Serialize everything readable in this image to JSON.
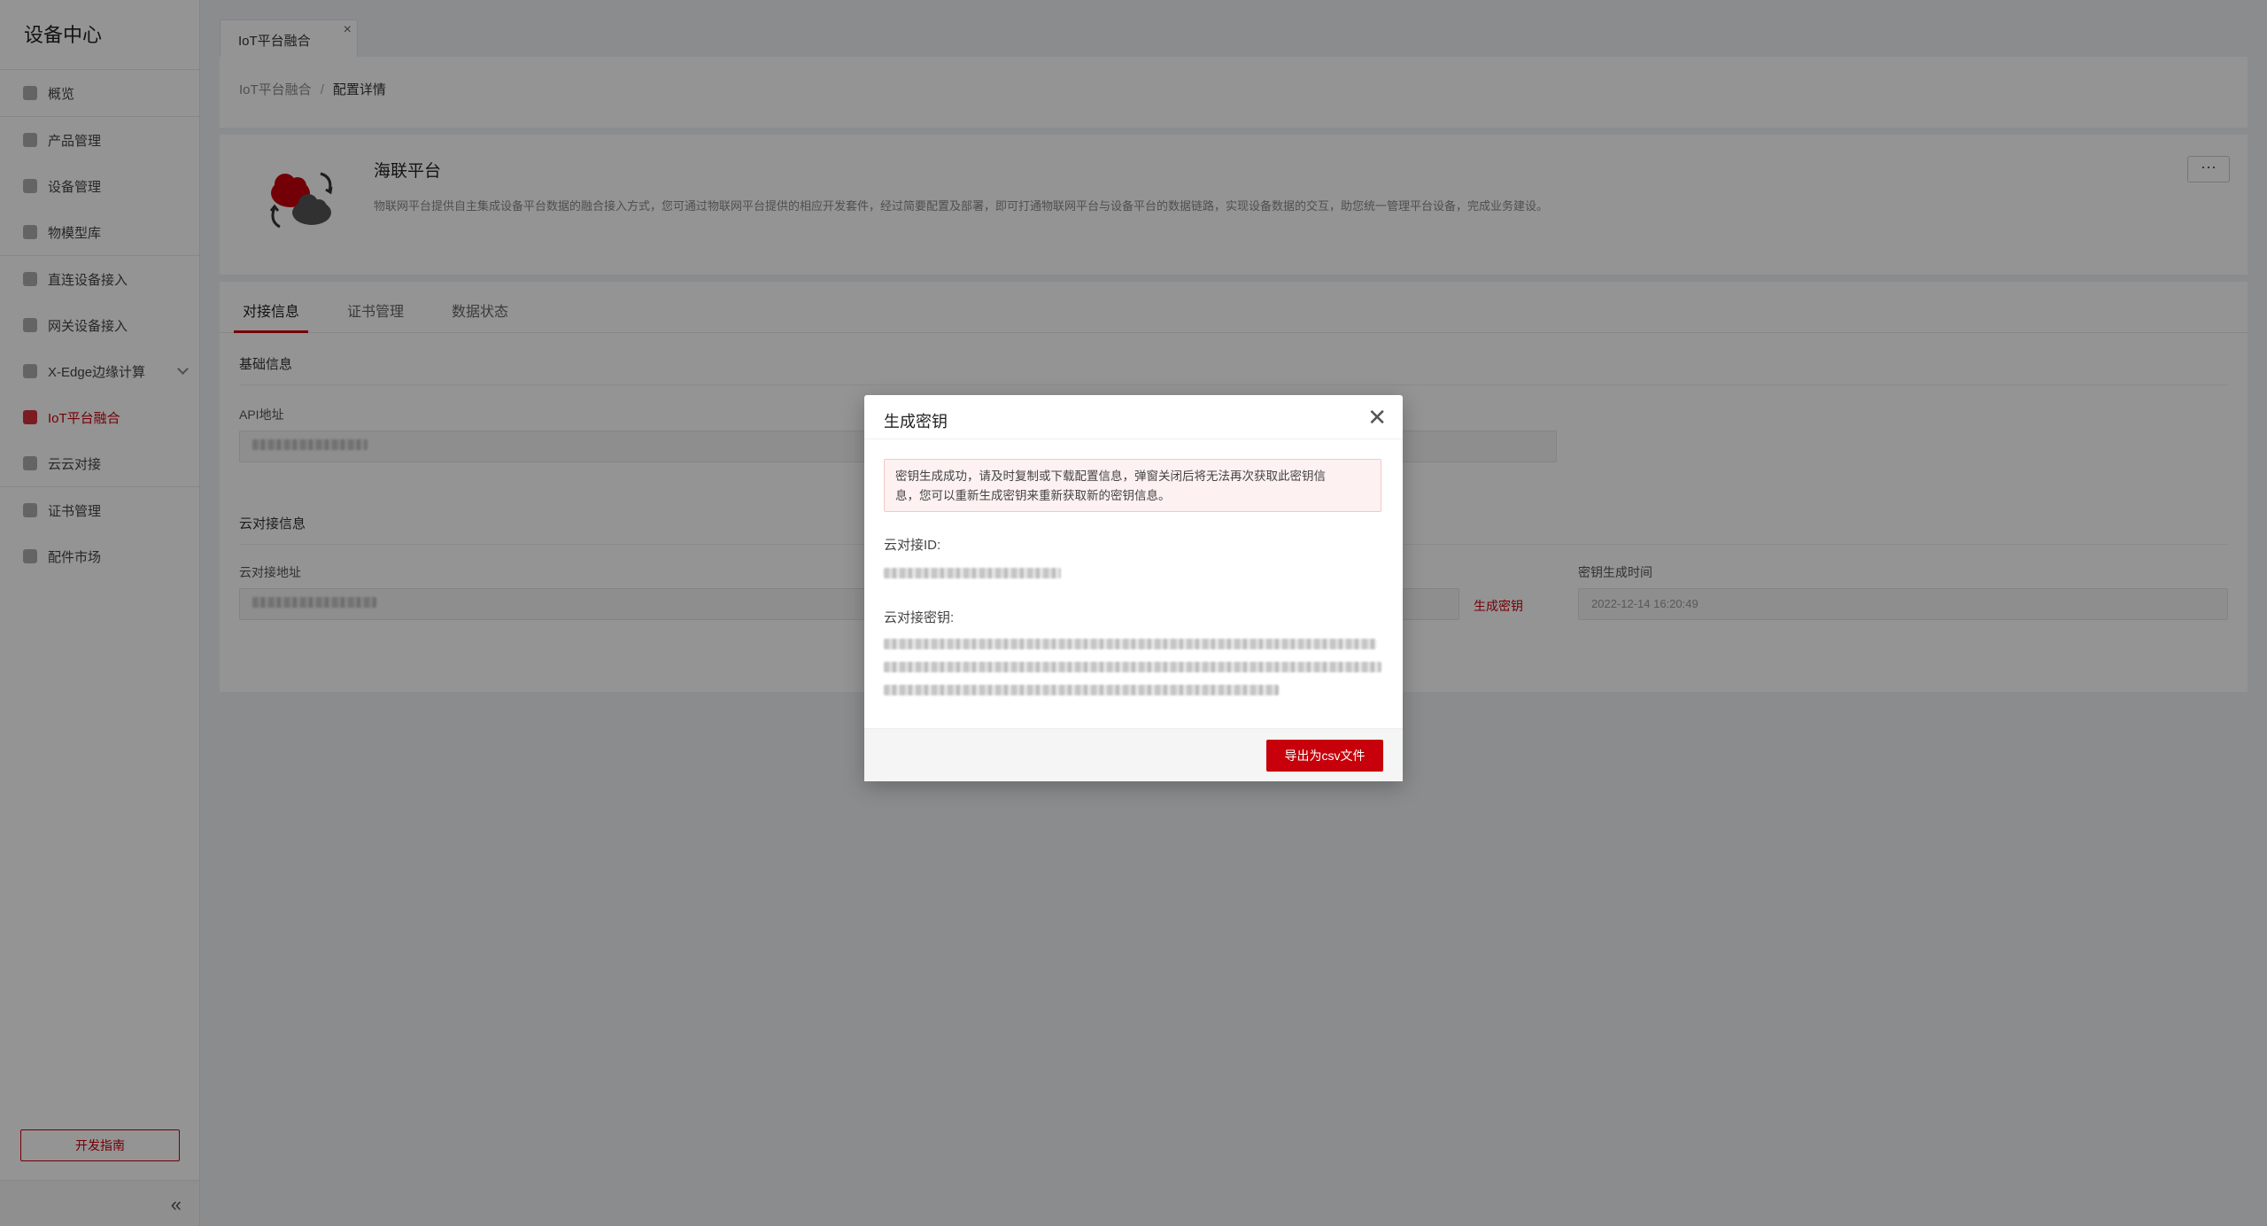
{
  "sidebar": {
    "title": "设备中心",
    "items": [
      {
        "label": "概览",
        "icon": "cube-icon"
      },
      {
        "label": "产品管理",
        "icon": "box-icon"
      },
      {
        "label": "设备管理",
        "icon": "device-icon"
      },
      {
        "label": "物模型库",
        "icon": "model-icon"
      },
      {
        "label": "直连设备接入",
        "icon": "direct-icon"
      },
      {
        "label": "网关设备接入",
        "icon": "gateway-icon"
      },
      {
        "label": "X-Edge边缘计算",
        "icon": "grid-icon"
      },
      {
        "label": "IoT平台融合",
        "icon": "iot-icon"
      },
      {
        "label": "云云对接",
        "icon": "cloud-icon"
      },
      {
        "label": "证书管理",
        "icon": "certificate-icon"
      },
      {
        "label": "配件市场",
        "icon": "market-icon"
      }
    ],
    "guide_label": "开发指南",
    "collapse_glyph": "«"
  },
  "page_tab": {
    "label": "IoT平台融合",
    "close_glyph": "×"
  },
  "breadcrumb": {
    "root": "IoT平台融合",
    "sep": "/",
    "current": "配置详情"
  },
  "platform": {
    "name": "海联平台",
    "desc": "物联网平台提供自主集成设备平台数据的融合接入方式，您可通过物联网平台提供的相应开发套件，经过简要配置及部署，即可打通物联网平台与设备平台的数据链路，实现设备数据的交互，助您统一管理平台设备，完成业务建设。",
    "more_glyph": "···"
  },
  "tabs": [
    "对接信息",
    "证书管理",
    "数据状态"
  ],
  "basic": {
    "title": "基础信息",
    "api_label": "API地址"
  },
  "cloud": {
    "title": "云对接信息",
    "addr_label": "云对接地址",
    "gen_link": "生成密钥",
    "time_label": "密钥生成时间",
    "time_value": "2022-12-14 16:20:49"
  },
  "modal": {
    "title": "生成密钥",
    "close_glyph": "✕",
    "alert_line1": "密钥生成成功，请及时复制或下载配置信息，弹窗关闭后将无法再次获取此密钥信",
    "alert_line2": "息，您可以重新生成密钥来重新获取新的密钥信息。",
    "id_label": "云对接ID:",
    "secret_label": "云对接密钥:",
    "export_label": "导出为csv文件"
  }
}
